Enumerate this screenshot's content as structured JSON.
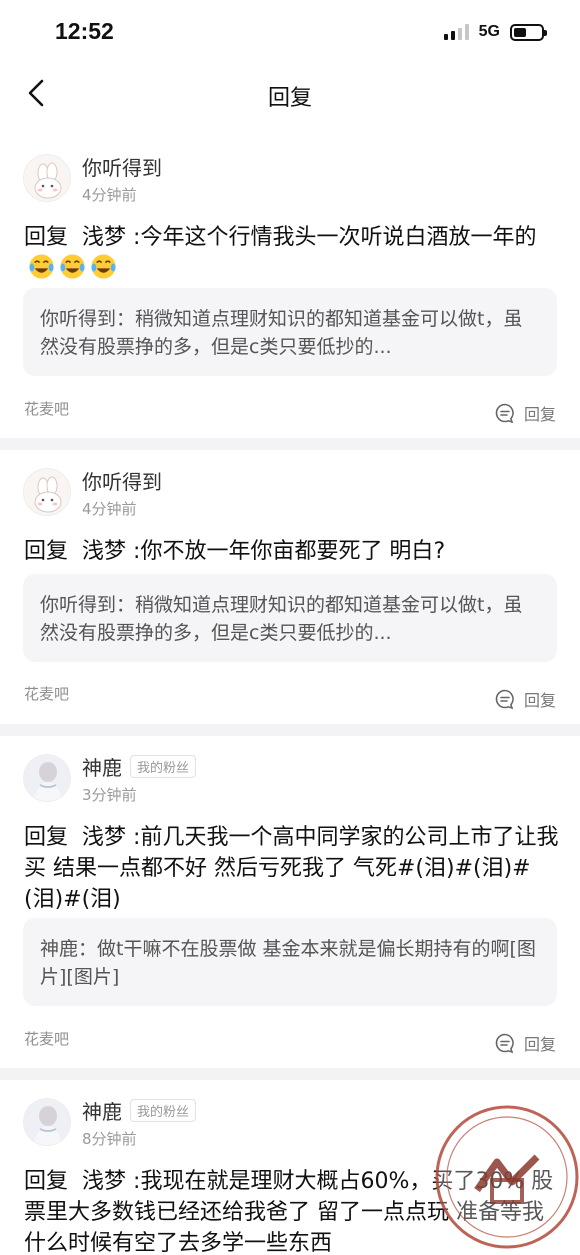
{
  "status": {
    "time": "12:52",
    "network": "5G"
  },
  "nav": {
    "title": "回复"
  },
  "replies": [
    {
      "user": "你听得到",
      "time": "4分钟前",
      "prefix": "回复",
      "target": "浅梦",
      "text": ":今年这个行情我头一次听说白酒放一年的",
      "emojis": [
        "laugh-cry-icon",
        "laugh-cry-icon",
        "laugh-cry-icon"
      ],
      "quote": "你听得到：稍微知道点理财知识的都知道基金可以做t，虽然没有股票挣的多，但是c类只要低抄的...",
      "source": "花麦吧",
      "reply_label": "回复"
    },
    {
      "user": "你听得到",
      "time": "4分钟前",
      "prefix": "回复",
      "target": "浅梦",
      "text": ":你不放一年你亩都要死了 明白?",
      "quote": "你听得到：稍微知道点理财知识的都知道基金可以做t，虽然没有股票挣的多，但是c类只要低抄的...",
      "source": "花麦吧",
      "reply_label": "回复"
    },
    {
      "user": "神鹿",
      "badge": "我的粉丝",
      "time": "3分钟前",
      "prefix": "回复",
      "target": "浅梦",
      "text": ":前几天我一个高中同学家的公司上市了让我买 结果一点都不好 然后亏死我了 气死#(泪)#(泪)#(泪)#(泪)",
      "quote": "神鹿：做t干嘛不在股票做 基金本来就是偏长期持有的啊[图片][图片]",
      "source": "花麦吧",
      "reply_label": "回复"
    },
    {
      "user": "神鹿",
      "badge": "我的粉丝",
      "time": "8分钟前",
      "prefix": "回复",
      "target": "浅梦",
      "text": ":我现在就是理财大概占60%，买了30% 股票里大多数钱已经还给我爸了 留了一点点玩 准备等我什么时候有空了去多学一些东西"
    }
  ],
  "watermark": {
    "text": "第一私募",
    "url": "SIMU001.cn"
  }
}
